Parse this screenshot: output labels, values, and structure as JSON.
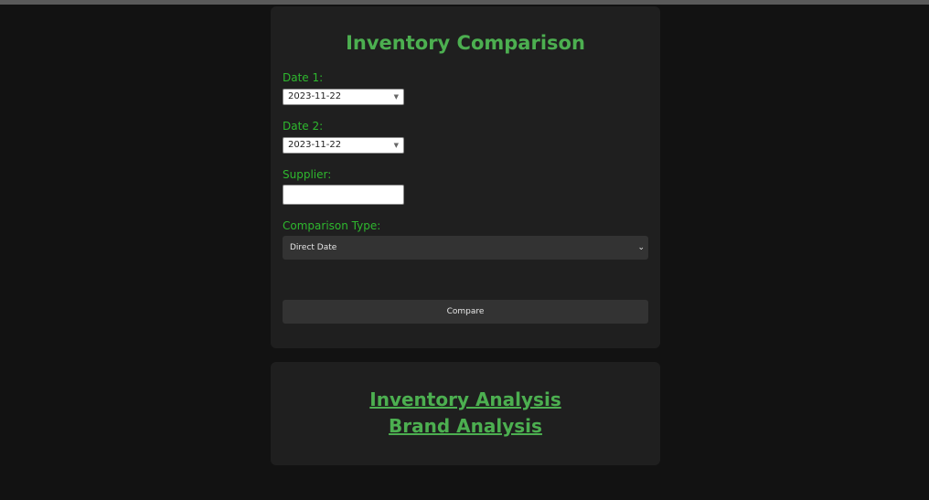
{
  "form": {
    "title": "Inventory Comparison",
    "date1": {
      "label": "Date 1:",
      "value": "2023-11-22"
    },
    "date2": {
      "label": "Date 2:",
      "value": "2023-11-22"
    },
    "supplier": {
      "label": "Supplier:",
      "value": ""
    },
    "comparison_type": {
      "label": "Comparison Type:",
      "selected": "Direct Date"
    },
    "compare_label": "Compare"
  },
  "links": {
    "inventory_analysis": "Inventory Analysis",
    "brand_analysis": "Brand Analysis"
  },
  "colors": {
    "accent": "#4caf50",
    "label_green": "#2eb82e",
    "background": "#121212",
    "card": "#1f1f1f",
    "control": "#333333"
  }
}
